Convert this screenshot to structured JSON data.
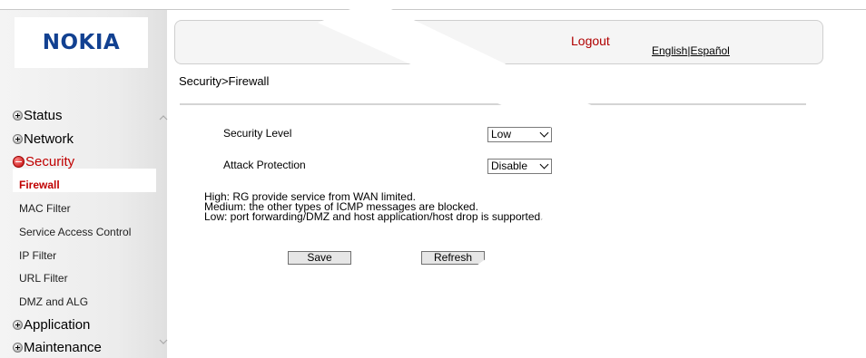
{
  "brand": {
    "logo": "NOKIA",
    "logo_color": "#124191"
  },
  "header": {
    "logout": "Logout",
    "lang_english": "English",
    "lang_separator": "|",
    "lang_spanish": "Español"
  },
  "breadcrumb": "Security>Firewall",
  "sidebar": {
    "categories": [
      {
        "label": "Status",
        "icon": "plus-icon"
      },
      {
        "label": "Network",
        "icon": "plus-icon"
      },
      {
        "label": "Security",
        "icon": "minus-icon",
        "active": true
      },
      {
        "label": "Application",
        "icon": "plus-icon"
      },
      {
        "label": "Maintenance",
        "icon": "plus-icon"
      }
    ],
    "security_items": [
      "Firewall",
      "MAC Filter",
      "Service Access Control",
      "IP Filter",
      "URL Filter",
      "DMZ and ALG"
    ]
  },
  "form": {
    "security_level_label": "Security Level",
    "security_level_value": "Low",
    "attack_protection_label": "Attack Protection",
    "attack_protection_value": "Disable"
  },
  "description": {
    "high": "High: RG provide service from WAN limited.",
    "medium": "Medium: the other types of ICMP messages are blocked.",
    "low": "Low: port forwarding/DMZ and host application/host drop is supported."
  },
  "buttons": {
    "save": "Save",
    "refresh": "Refresh"
  },
  "colors": {
    "accent": "#c00000",
    "logout": "#b00000"
  }
}
